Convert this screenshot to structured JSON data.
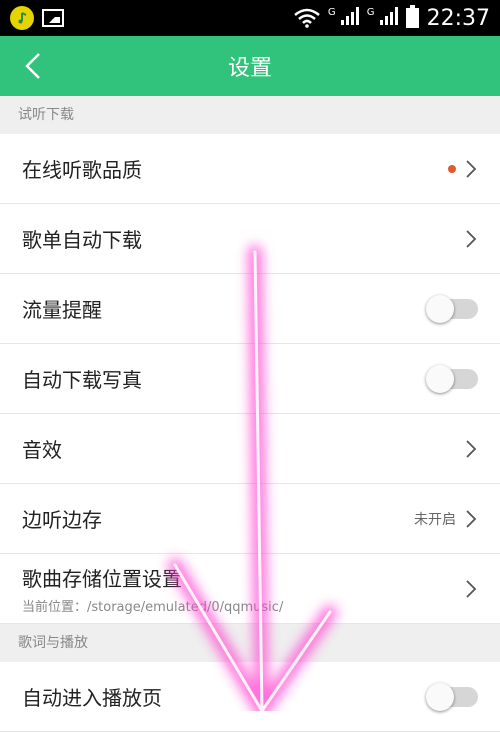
{
  "status_bar": {
    "time": "22:37",
    "network1": "G",
    "network2": "G"
  },
  "header": {
    "title": "设置"
  },
  "sections": {
    "audition_download": {
      "title": "试听下载",
      "online_quality": {
        "label": "在线听歌品质"
      },
      "playlist_auto_download": {
        "label": "歌单自动下载"
      },
      "data_reminder": {
        "label": "流量提醒"
      },
      "auto_download_photos": {
        "label": "自动下载写真"
      },
      "sound_effects": {
        "label": "音效"
      },
      "listen_while_saving": {
        "label": "边听边存",
        "value": "未开启"
      },
      "storage_location": {
        "label": "歌曲存储位置设置",
        "sub": "当前位置：/storage/emulated/0/qqmusic/"
      }
    },
    "lyrics_playback": {
      "title": "歌词与播放",
      "auto_enter_player": {
        "label": "自动进入播放页"
      }
    }
  },
  "colors": {
    "accent": "#31c27c",
    "dot": "#e05a2b",
    "annotation": "#ff40d0"
  }
}
